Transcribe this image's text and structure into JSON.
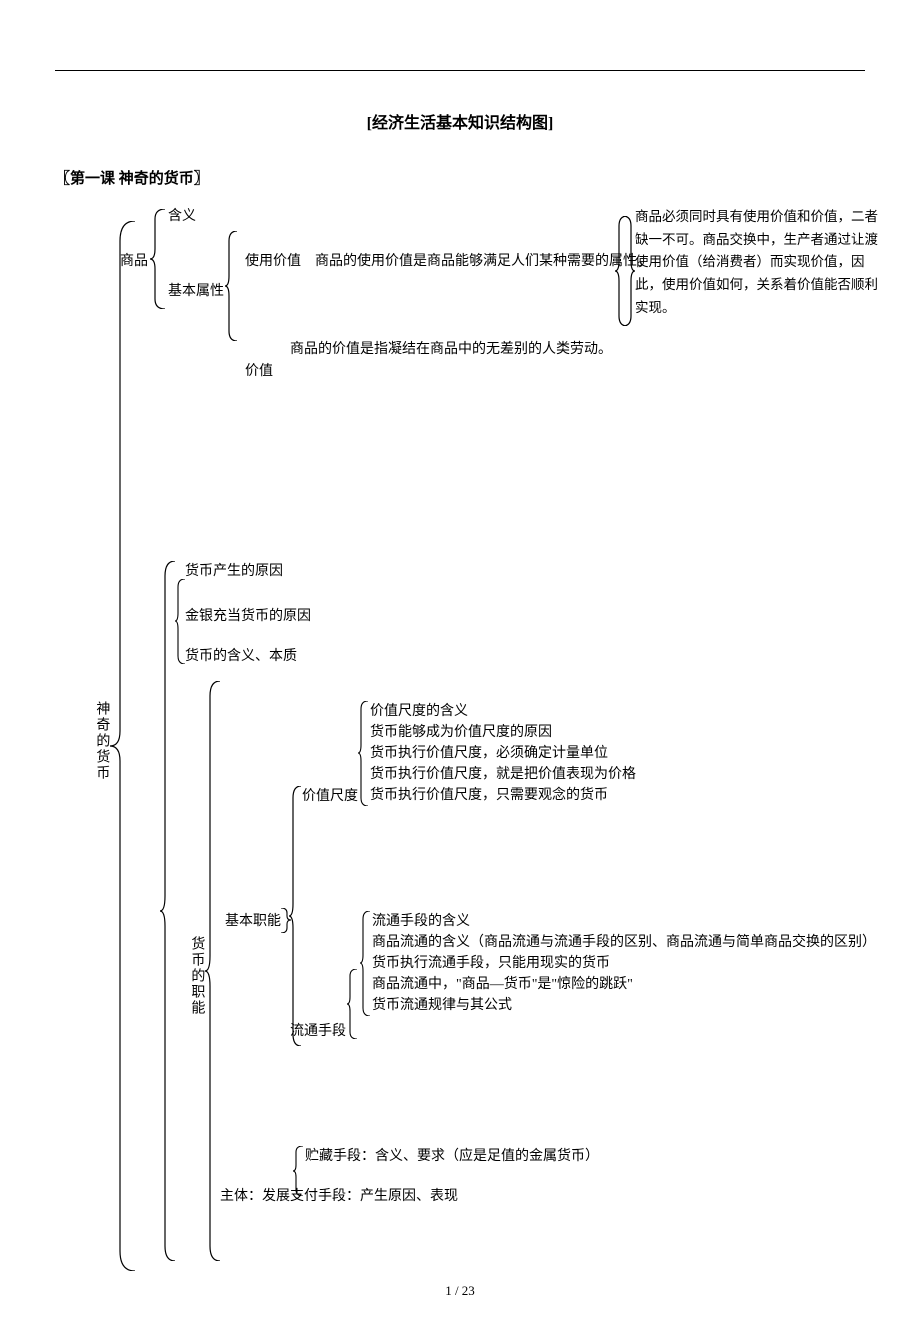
{
  "title": "[经济生活基本知识结构图]",
  "lesson": "〖第一课  神奇的货币〗",
  "root": "神奇的货币",
  "commodity": {
    "label": "商品",
    "meaning": "含义",
    "attrs_label": "基本属性",
    "use_value_label": "使用价值",
    "use_value_desc": "商品的使用价值是商品能够满足人们某种需要的属性。",
    "value_label": "价值",
    "value_desc": "商品的价值是指凝结在商品中的无差别的人类劳动。"
  },
  "note": "商品必须同时具有使用价值和价值，二者缺一不可。商品交换中，生产者通过让渡使用价值（给消费者）而实现价值，因此，使用价值如何，关系着价值能否顺利实现。",
  "currency_section": {
    "origin": "货币产生的原因",
    "gold_silver": "金银充当货币的原因",
    "meaning_nature": "货币的含义、本质",
    "functions_label": "货币的职能",
    "basic_func_label": "基本职能",
    "value_measure_label": "价值尺度",
    "value_measure": {
      "l1": "价值尺度的含义",
      "l2": "货币能够成为价值尺度的原因",
      "l3": "货币执行价值尺度，必须确定计量单位",
      "l4": "货币执行价值尺度，就是把价值表现为价格",
      "l5": "货币执行价值尺度，只需要观念的货币"
    },
    "circulation_label": "流通手段",
    "circulation": {
      "l1": "流通手段的含义",
      "l2": "商品流通的含义（商品流通与流通手段的区别、商品流通与简单商品交换的区别）",
      "l3": "货币执行流通手段，只能用现实的货币",
      "l4": "商品流通中，\"商品—货币\"是\"惊险的跳跃\"",
      "l5": "货币流通规律与其公式"
    },
    "main_body_label": "主体：发展",
    "storage": "贮藏手段：含义、要求（应是足值的金属货币）",
    "payment": "支付手段：产生原因、表现"
  },
  "page_num": "1  / 23"
}
